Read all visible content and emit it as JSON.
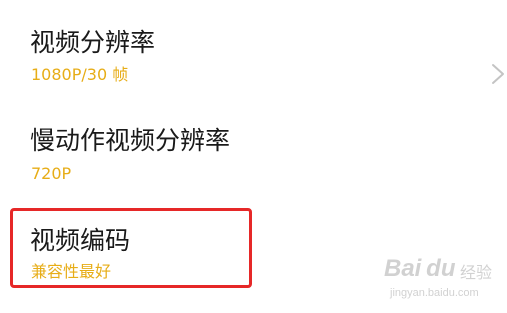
{
  "settings": {
    "items": [
      {
        "title": "视频分辨率",
        "value": "1080P/30 帧",
        "has_chevron": true
      },
      {
        "title": "慢动作视频分辨率",
        "value": "720P"
      },
      {
        "title": "视频编码",
        "value": "兼容性最好",
        "highlighted": true
      }
    ]
  },
  "watermark": {
    "brand": "Bai du",
    "label": "经验",
    "url": "jingyan.baidu.com"
  },
  "colors": {
    "title": "#1a1a1a",
    "value_accent": "#e7ad17",
    "highlight_border": "#e62828",
    "chevron": "#c4c4c4"
  },
  "icons": {
    "chevron": "chevron-right-icon"
  }
}
